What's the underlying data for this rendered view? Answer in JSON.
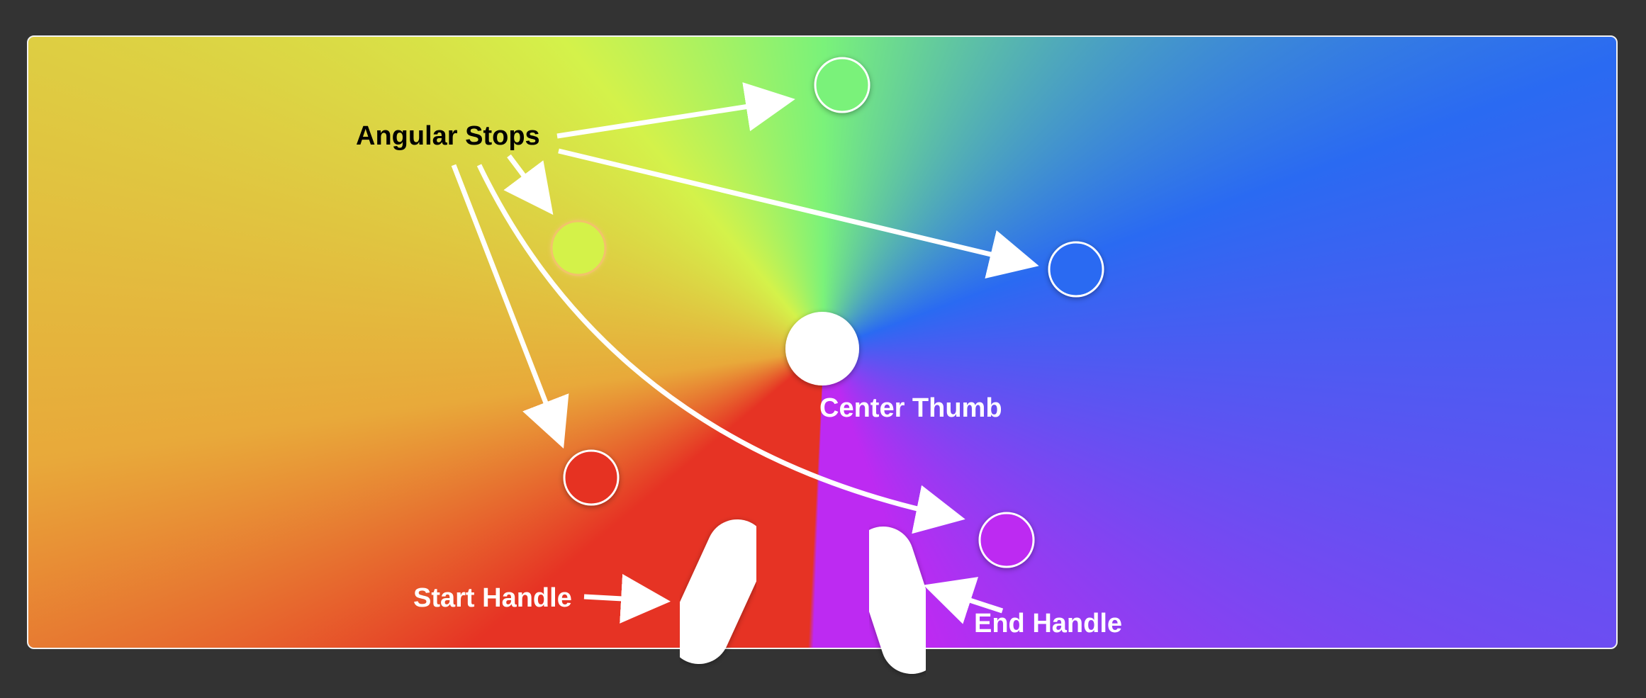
{
  "labels": {
    "angular_stops": "Angular Stops",
    "center_thumb": "Center Thumb",
    "start_handle": "Start Handle",
    "end_handle": "End Handle"
  },
  "colors": {
    "background": "#333333",
    "panel_border": "#f2f2f2",
    "red": "#e63324",
    "purple": "#bd2af2",
    "blue": "#2a6af2",
    "green": "#7af27a",
    "yellow_green": "#d4f24a",
    "orange": "#e8a93a",
    "stop_outline": "#ffffff",
    "label_dark": "#000000",
    "label_light": "#ffffff"
  },
  "gradient": {
    "type": "angular",
    "stops": [
      {
        "name": "green",
        "color": "#7af27a"
      },
      {
        "name": "blue",
        "color": "#2a6af2"
      },
      {
        "name": "purple",
        "color": "#bd2af2"
      },
      {
        "name": "red",
        "color": "#e63324"
      },
      {
        "name": "orange",
        "color": "#e8a93a"
      },
      {
        "name": "yellow",
        "color": "#d4f24a"
      }
    ]
  }
}
